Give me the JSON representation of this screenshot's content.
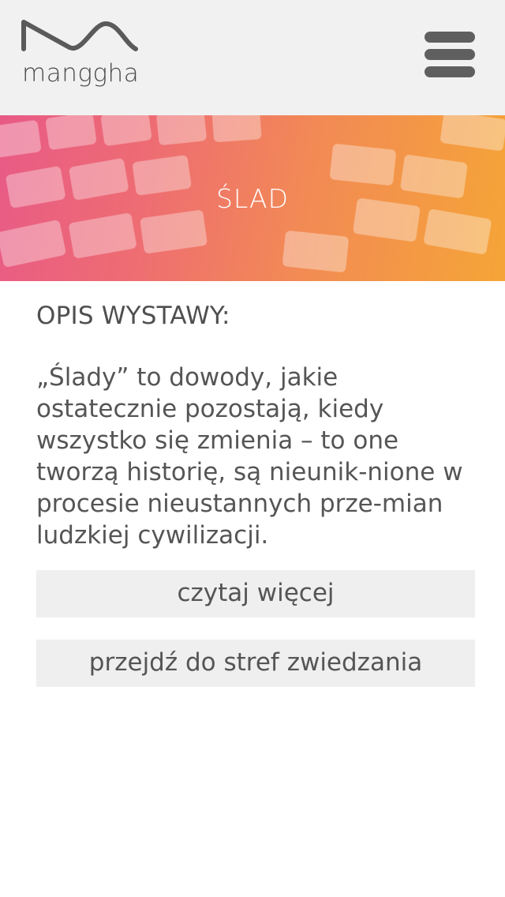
{
  "header": {
    "logo_text": "manggha",
    "background": "#f1f1f1"
  },
  "hero": {
    "title": "ŚLAD",
    "gradient_start": "#e85a86",
    "gradient_end": "#f5a537"
  },
  "main": {
    "heading": "OPIS WYSTAWY:",
    "description": "„Ślady” to dowody, jakie ostatecznie pozostają, kiedy wszystko się zmienia – to one tworzą historię, są nieunik-nione w procesie nieustannych prze-mian ludzkiej cywilizacji."
  },
  "buttons": {
    "read_more": "czytaj więcej",
    "visit_zones": "przejdź do stref zwiedzania"
  },
  "icons": {
    "menu": "hamburger-menu-icon",
    "logo_mark": "wave-logo-icon"
  }
}
